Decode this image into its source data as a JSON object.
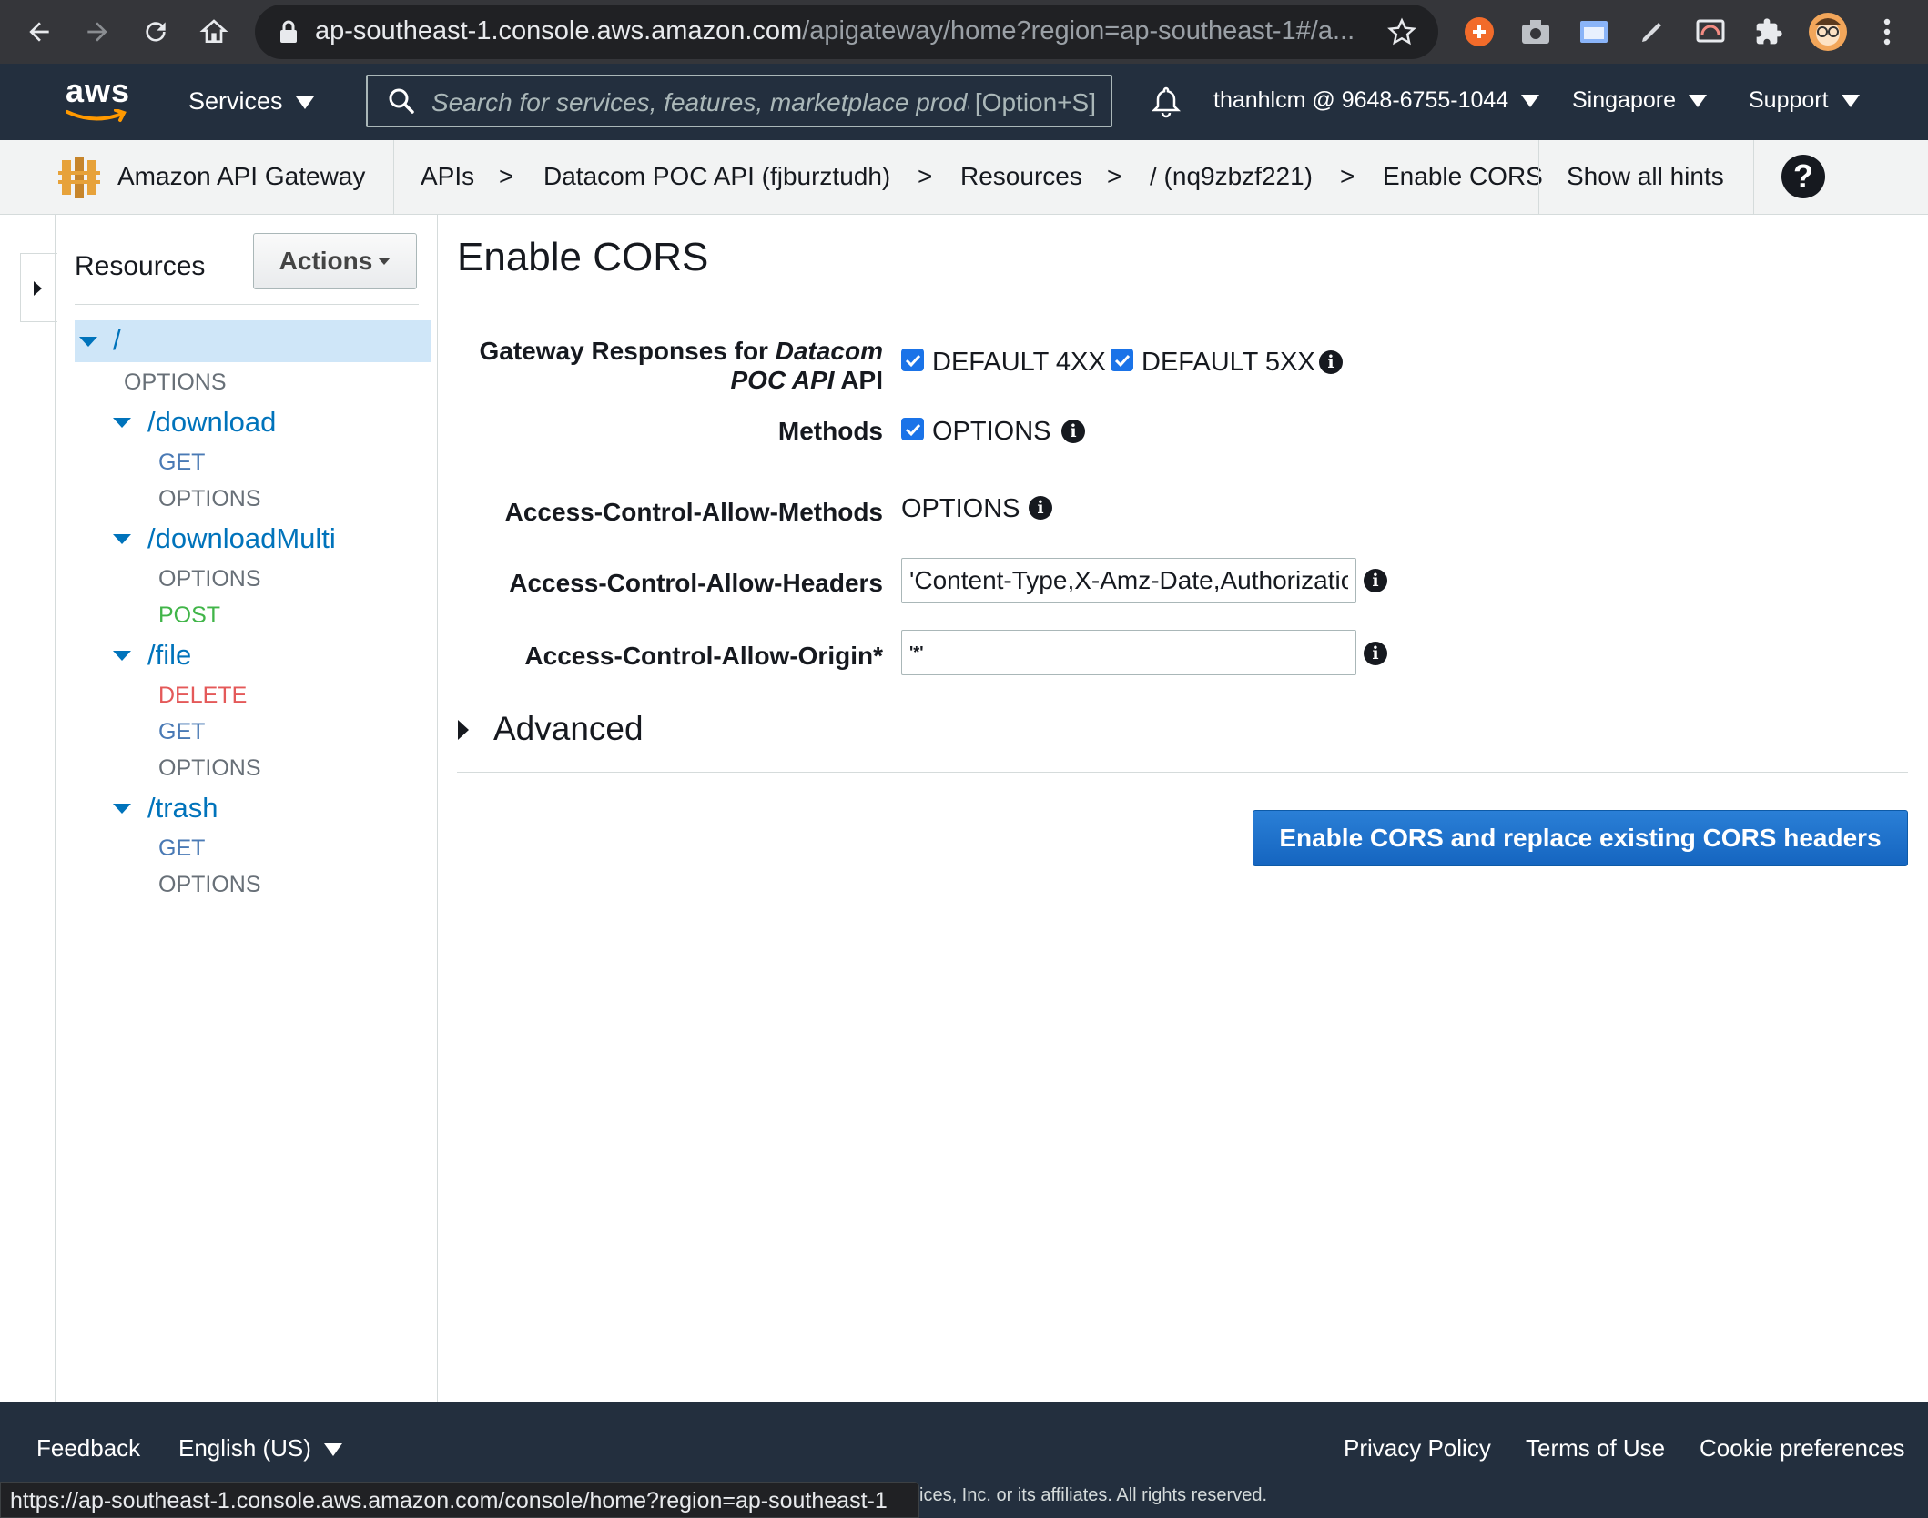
{
  "browser": {
    "url_host": "ap-southeast-1.console.aws.amazon.com",
    "url_path": "/apigateway/home?region=ap-southeast-1#/a...",
    "icons": [
      "back-icon",
      "forward-icon",
      "reload-icon",
      "home-icon",
      "lock-icon",
      "star-icon",
      "extension-icon",
      "profile-avatar",
      "menu-icon"
    ]
  },
  "awsnav": {
    "logo_text": "aws",
    "services_label": "Services",
    "search_placeholder": "Search for services, features, marketplace products, and docs",
    "search_shortcut": "[Option+S]",
    "account": "thanhlcm @ 9648-6755-1044",
    "region": "Singapore",
    "support": "Support"
  },
  "service_bar": {
    "service_name": "Amazon API Gateway",
    "breadcrumbs": [
      "APIs",
      "Datacom POC API (fjburztudh)",
      "Resources",
      "/ (nq9zbzf221)",
      "Enable CORS"
    ],
    "separator": ">",
    "show_hints": "Show all hints",
    "help_icon": "?"
  },
  "sidebar": {
    "title": "Resources",
    "actions_label": "Actions",
    "root": "/",
    "root_methods": [
      "OPTIONS"
    ],
    "resources": [
      {
        "path": "/download",
        "methods": [
          "GET",
          "OPTIONS"
        ]
      },
      {
        "path": "/downloadMulti",
        "methods": [
          "OPTIONS",
          "POST"
        ]
      },
      {
        "path": "/file",
        "methods": [
          "DELETE",
          "GET",
          "OPTIONS"
        ]
      },
      {
        "path": "/trash",
        "methods": [
          "GET",
          "OPTIONS"
        ]
      }
    ]
  },
  "main": {
    "title": "Enable CORS",
    "gateway_label_1a": "Gateway Responses for ",
    "gateway_label_1b": "Datacom",
    "gateway_label_2a": "POC API",
    "gateway_label_2b": " API",
    "default_4xx": "DEFAULT 4XX",
    "default_5xx": "DEFAULT 5XX",
    "methods_label": "Methods",
    "methods_option": "OPTIONS",
    "allow_methods_label": "Access-Control-Allow-Methods",
    "allow_methods_value": "OPTIONS",
    "allow_headers_label": "Access-Control-Allow-Headers",
    "allow_headers_value": "'Content-Type,X-Amz-Date,Authorization,X-Api-Key,X-Amz-Security-Token'",
    "allow_origin_label": "Access-Control-Allow-Origin*",
    "allow_origin_value": "'*'",
    "advanced_label": "Advanced",
    "enable_button": "Enable CORS and replace existing CORS headers"
  },
  "footer": {
    "feedback": "Feedback",
    "language": "English (US)",
    "privacy": "Privacy Policy",
    "terms": "Terms of Use",
    "cookies": "Cookie preferences",
    "copyright": "ices, Inc. or its affiliates. All rights reserved.",
    "status_url": "https://ap-southeast-1.console.aws.amazon.com/console/home?region=ap-southeast-1"
  },
  "colors": {
    "aws_nav": "#232f3e",
    "link_blue": "#0073bb",
    "button_blue": "#1a73e8",
    "post_green": "#41b549",
    "delete_red": "#e45959",
    "aws_orange": "#ff9900"
  }
}
